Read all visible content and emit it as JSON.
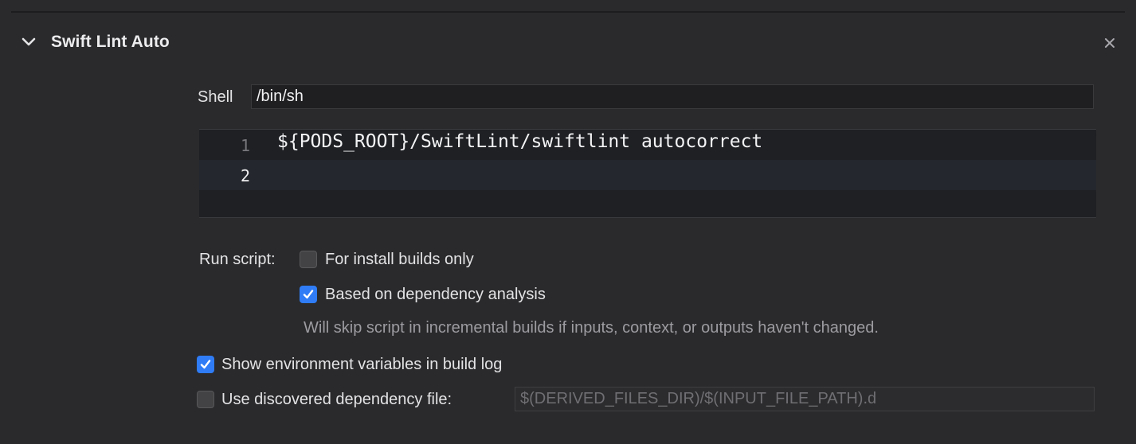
{
  "phase": {
    "title": "Swift Lint Auto",
    "chevron_icon": "chevron-down-icon",
    "close_icon": "close-icon"
  },
  "shell": {
    "label": "Shell",
    "value": "/bin/sh"
  },
  "script_editor": {
    "lines": [
      {
        "number": "1",
        "text": "${PODS_ROOT}/SwiftLint/swiftlint autocorrect"
      },
      {
        "number": "2",
        "text": ""
      }
    ]
  },
  "run_script": {
    "label": "Run script:",
    "install_builds_only": {
      "label": "For install builds only",
      "checked": false
    },
    "dependency_analysis": {
      "label": "Based on dependency analysis",
      "checked": true
    },
    "hint": "Will skip script in incremental builds if inputs, context, or outputs haven't changed."
  },
  "show_env_vars": {
    "label": "Show environment variables in build log",
    "checked": true
  },
  "discovered_dependency": {
    "label": "Use discovered dependency file:",
    "checked": false,
    "placeholder": "$(DERIVED_FILES_DIR)/$(INPUT_FILE_PATH).d"
  },
  "colors": {
    "background": "#2a2a2c",
    "editor_background": "#1e2024",
    "accent": "#2f7cf6"
  }
}
